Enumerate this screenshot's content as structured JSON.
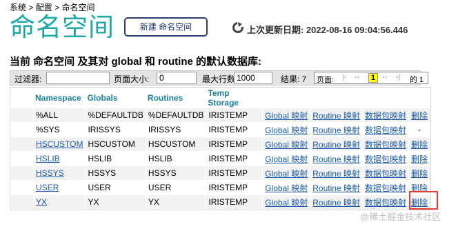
{
  "breadcrumb": {
    "items": [
      "系统",
      "配置",
      "命名空间"
    ],
    "sep": ">"
  },
  "page_title": "命名空间",
  "new_button": "新建 命名空间",
  "last_update": "上次更新日期: 2022-08-16 09:04:56.446",
  "heading": "当前 命名空间 及其对 global 和 routine 的默认数据库:",
  "toolbar": {
    "filter_label": "过滤器:",
    "filter_value": "",
    "page_size_label": "页面大小:",
    "page_size_value": "0",
    "max_rows_label": "最大行数:",
    "max_rows_value": "1000",
    "results_label": "结果: 7",
    "pager": {
      "page_label": "页面:",
      "first": "|‹",
      "prev": "‹‹",
      "current": "1",
      "next": "››",
      "last": "›|",
      "of_label": "的 1"
    }
  },
  "table": {
    "headers": [
      "Namespace",
      "Globals",
      "Routines",
      "Temp Storage"
    ],
    "rows": [
      {
        "ns": "%ALL",
        "globals": "%DEFAULTDB",
        "routines": "%DEFAULTDB",
        "temp": "IRISTEMP",
        "global_map": "Global 映射",
        "routine_map": "Routine 映射",
        "pkg_map": "数据包映射",
        "delete": "删除"
      },
      {
        "ns": "%SYS",
        "globals": "IRISSYS",
        "routines": "IRISSYS",
        "temp": "IRISTEMP",
        "global_map": "Global 映射",
        "routine_map": "Routine 映射",
        "pkg_map": "数据包映射",
        "delete": "-"
      },
      {
        "ns": "HSCUSTOM",
        "globals": "HSCUSTOM",
        "routines": "HSCUSTOM",
        "temp": "IRISTEMP",
        "global_map": "Global 映射",
        "routine_map": "Routine 映射",
        "pkg_map": "数据包映射",
        "delete": "删除"
      },
      {
        "ns": "HSLIB",
        "globals": "HSLIB",
        "routines": "HSLIB",
        "temp": "IRISTEMP",
        "global_map": "Global 映射",
        "routine_map": "Routine 映射",
        "pkg_map": "数据包映射",
        "delete": "删除"
      },
      {
        "ns": "HSSYS",
        "globals": "HSSYS",
        "routines": "HSSYS",
        "temp": "IRISTEMP",
        "global_map": "Global 映射",
        "routine_map": "Routine 映射",
        "pkg_map": "数据包映射",
        "delete": "删除"
      },
      {
        "ns": "USER",
        "globals": "USER",
        "routines": "USER",
        "temp": "IRISTEMP",
        "global_map": "Global 映射",
        "routine_map": "Routine 映射",
        "pkg_map": "数据包映射",
        "delete": "删除"
      },
      {
        "ns": "YX",
        "globals": "YX",
        "routines": "YX",
        "temp": "IRISTEMP",
        "global_map": "Global 映射",
        "routine_map": "Routine 映射",
        "pkg_map": "数据包映射",
        "delete": "删除"
      }
    ]
  },
  "watermark": "@稀土掘金技术社区",
  "colors": {
    "title": "#1ca8a6",
    "header": "#1a7f9e",
    "link": "#1a5aa8",
    "highlight": "#e53935",
    "pager_current": "#ffff00"
  }
}
